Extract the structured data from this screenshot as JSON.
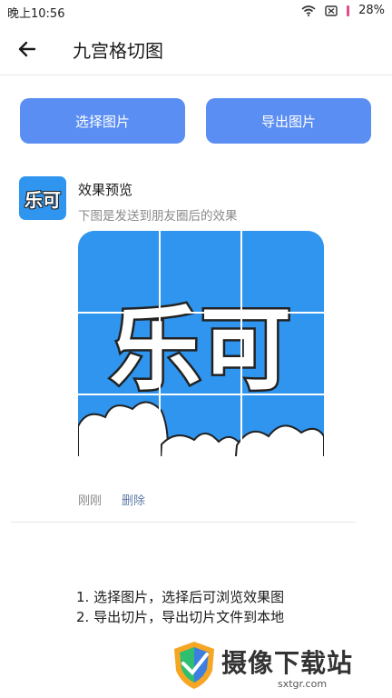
{
  "status_bar": {
    "time": "晚上10:56",
    "battery": "28%"
  },
  "app_bar": {
    "title": "九宫格切图"
  },
  "actions": {
    "select_label": "选择图片",
    "export_label": "导出图片"
  },
  "post": {
    "avatar_text": "乐可",
    "title": "效果预览",
    "subtitle": "下图是发送到朋友圈后的效果",
    "time": "刚刚",
    "delete_label": "删除",
    "preview_text": "乐可"
  },
  "instructions": {
    "line1": "1. 选择图片，选择后可浏览效果图",
    "line2": "2. 导出切片，导出切片文件到本地"
  },
  "watermark": {
    "brand": "摄像下载站",
    "url": "sxtgr.com"
  },
  "colors": {
    "accent": "#5b8ef2",
    "preview_bg": "#2f95ee"
  }
}
